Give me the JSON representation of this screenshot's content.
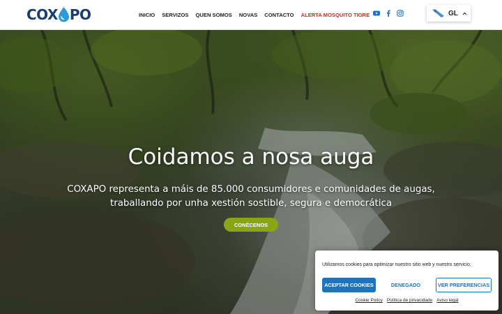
{
  "header": {
    "logo_left": "COX",
    "logo_right": "PO",
    "nav": [
      {
        "label": "INICIO"
      },
      {
        "label": "SERVIZOS"
      },
      {
        "label": "QUEN SOMOS"
      },
      {
        "label": "NOVAS"
      },
      {
        "label": "CONTACTO"
      },
      {
        "label": "ALERTA MOSQUITO TIGRE"
      }
    ],
    "socials": [
      "youtube-icon",
      "facebook-icon",
      "instagram-icon"
    ],
    "language": {
      "label": "GL"
    }
  },
  "hero": {
    "title": "Coidamos a nosa auga",
    "subtitle_line1": "COXAPO representa a máis de 85.000 consumidores e comunidades de augas,",
    "subtitle_line2": "traballando por unha xestión sostible, segura e democrática",
    "button": "CONÉCENOS"
  },
  "cookie_banner": {
    "text": "Utilizamos cookies para optimizar nuestro sitio web y nuestro servicio.",
    "accept": "ACEPTAR COOKIES",
    "deny": "DENEGADO",
    "preferences": "VER PREFERENCIAS",
    "links": [
      "Cookie Policy",
      "Política de privacidade",
      "Aviso legal"
    ]
  },
  "colors": {
    "brand_blue": "#1a3f6e",
    "accent_blue": "#1e73be",
    "alert_red": "#d7261c",
    "button_green": "#8aa515"
  }
}
